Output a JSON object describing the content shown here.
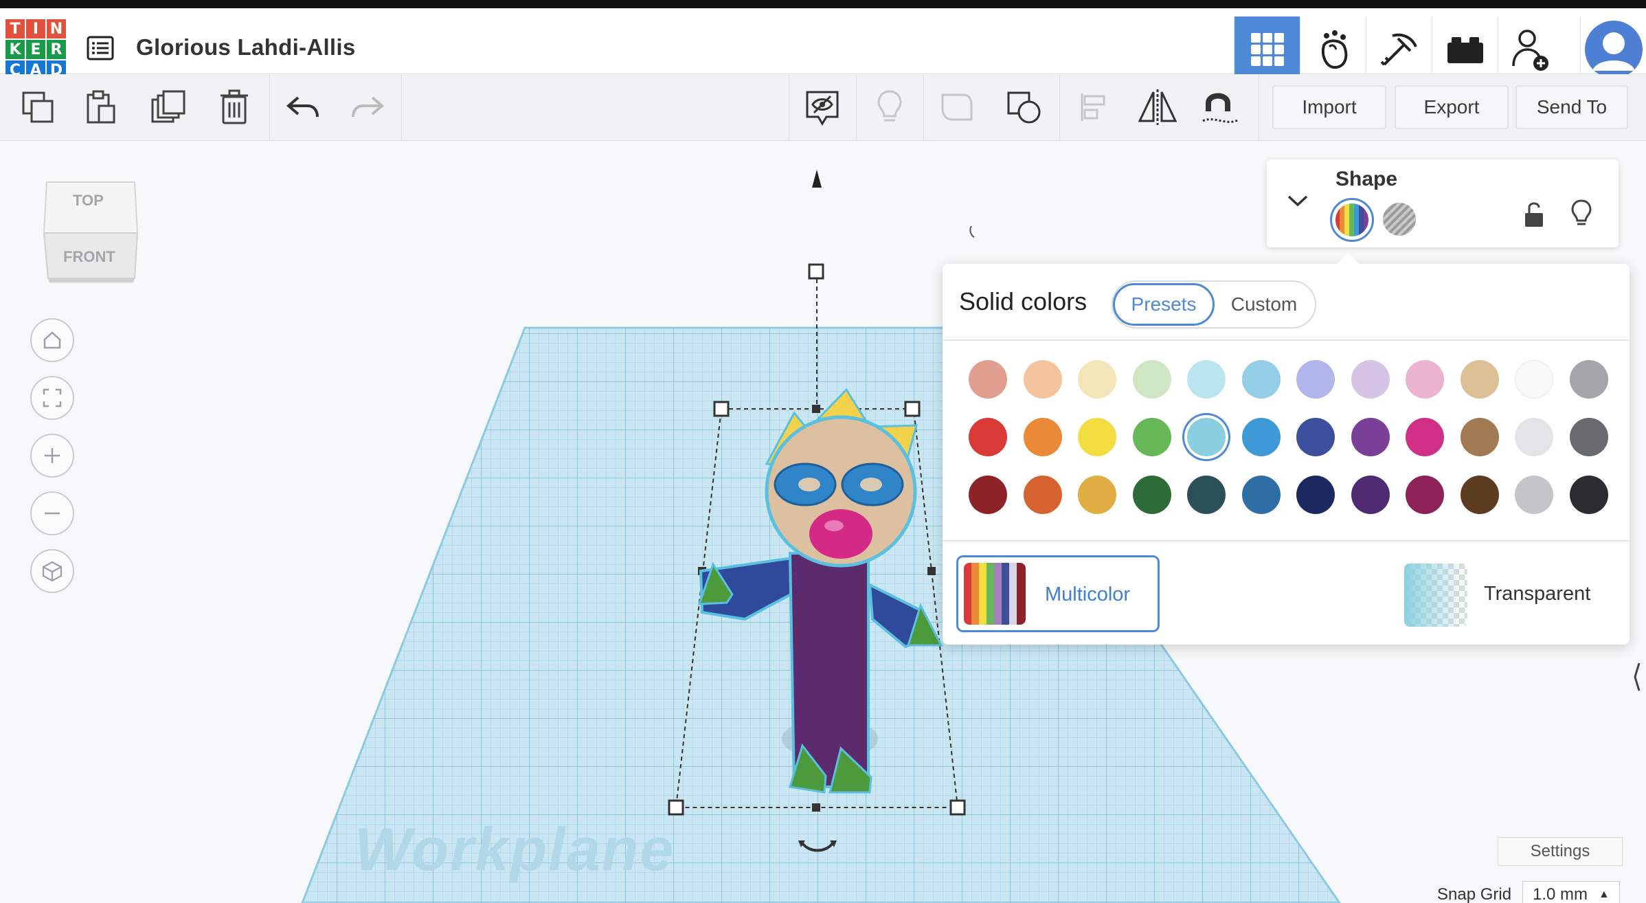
{
  "app": {
    "logo_letters": [
      "T",
      "I",
      "N",
      "K",
      "E",
      "R",
      "C",
      "A",
      "D"
    ],
    "logo_colors": [
      "#e2513c",
      "#e2513c",
      "#e2513c",
      "#1a9a49",
      "#1a9a49",
      "#1a9a49",
      "#1477d1",
      "#1477d1",
      "#1477d1"
    ],
    "doc_title": "Glorious Lahdi-Allis",
    "accent": "#4d89d6"
  },
  "topnav": {
    "icons": [
      "grid-view-icon",
      "sim-lab-icon",
      "blocks-pickaxe-icon",
      "bricks-icon",
      "add-user-icon",
      "user-avatar-icon"
    ]
  },
  "toolbar": {
    "import_label": "Import",
    "export_label": "Export",
    "send_label": "Send To"
  },
  "viewcube": {
    "top_label": "TOP",
    "front_label": "FRONT"
  },
  "workplane": {
    "label": "Workplane"
  },
  "shape_panel": {
    "title": "Shape"
  },
  "color_panel": {
    "heading": "Solid colors",
    "tab_presets": "Presets",
    "tab_custom": "Custom",
    "selected_color": "#89cfe0",
    "swatches": [
      [
        "#e09e8f",
        "#f3c49d",
        "#f4e5b8",
        "#cfe6c2",
        "#b8e5ee",
        "#94cde6",
        "#b0b5ea",
        "#d7c3e5",
        "#ecb2d2",
        "#dcbf94",
        "#f7f8f8",
        "#a2a6a9"
      ],
      [
        "#d93a35",
        "#ea8a36",
        "#f4dd40",
        "#67b957",
        "#89cfe0",
        "#3e9ad6",
        "#3d4f9c",
        "#7a3f97",
        "#d02f86",
        "#a17952",
        "#e2e4e5",
        "#676b6e"
      ],
      [
        "#8c2329",
        "#d6622f",
        "#dfad42",
        "#2d6b38",
        "#2a5058",
        "#2f6fa5",
        "#1c2961",
        "#4e2a70",
        "#8c2257",
        "#5c3d1f",
        "#c2c6c8",
        "#2b2d30"
      ]
    ],
    "multicolor_label": "Multicolor",
    "transparent_label": "Transparent"
  },
  "footer": {
    "settings_label": "Settings",
    "snap_label": "Snap Grid",
    "snap_value": "1.0 mm"
  }
}
